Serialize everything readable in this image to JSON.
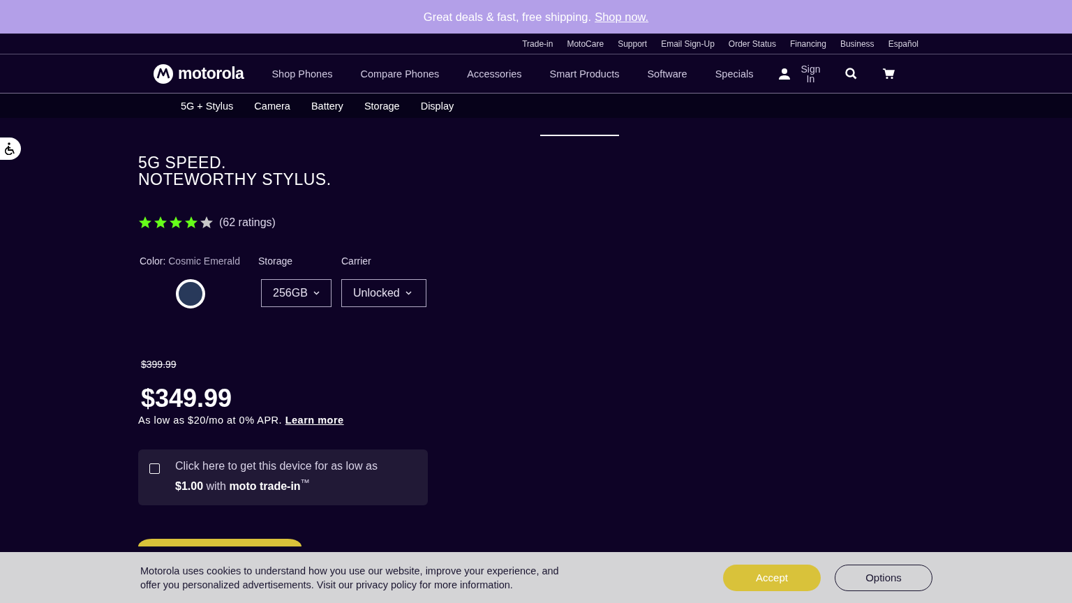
{
  "promo_bar": {
    "text": "Great deals & fast, free shipping.",
    "link": "Shop now."
  },
  "utility_links": [
    "Trade-in",
    "MotoCare",
    "Support",
    "Email Sign-Up",
    "Order Status",
    "Financing",
    "Business",
    "Español"
  ],
  "nav": {
    "logo": "motorola",
    "items": [
      "Shop Phones",
      "Compare Phones",
      "Accessories",
      "Smart Products",
      "Software",
      "Specials"
    ],
    "sign_in": "Sign In"
  },
  "sub_nav": [
    "5G + Stylus",
    "Camera",
    "Battery",
    "Storage",
    "Display"
  ],
  "product": {
    "headline_lines": [
      "5G SPEED.",
      "NOTEWORTHY STYLUS."
    ],
    "stars": 4,
    "ratings": "(62 ratings)",
    "color_label": "Color:",
    "color_value": "Cosmic Emerald",
    "swatch": {
      "color": "#28395a",
      "selected": true
    },
    "storage_label": "Storage",
    "storage_value": "256GB",
    "carrier_label": "Carrier",
    "carrier_value": "Unlocked",
    "old_price": "$399.99",
    "price": "$349.99",
    "financing": {
      "text": "As low as $20/mo at 0% APR.",
      "link": "Learn more"
    },
    "trade_in": {
      "checked": false,
      "text": "Click here to get this device for as low as **$1.00** with **moto trade-in**$^{™}$"
    }
  },
  "cookie_banner": {
    "text": "Motorola uses cookies to understand how you use our website, improve your experience, and offer you personalized advertisements. Visit our privacy policy for more information.",
    "accept": "Accept",
    "options": "Options"
  }
}
